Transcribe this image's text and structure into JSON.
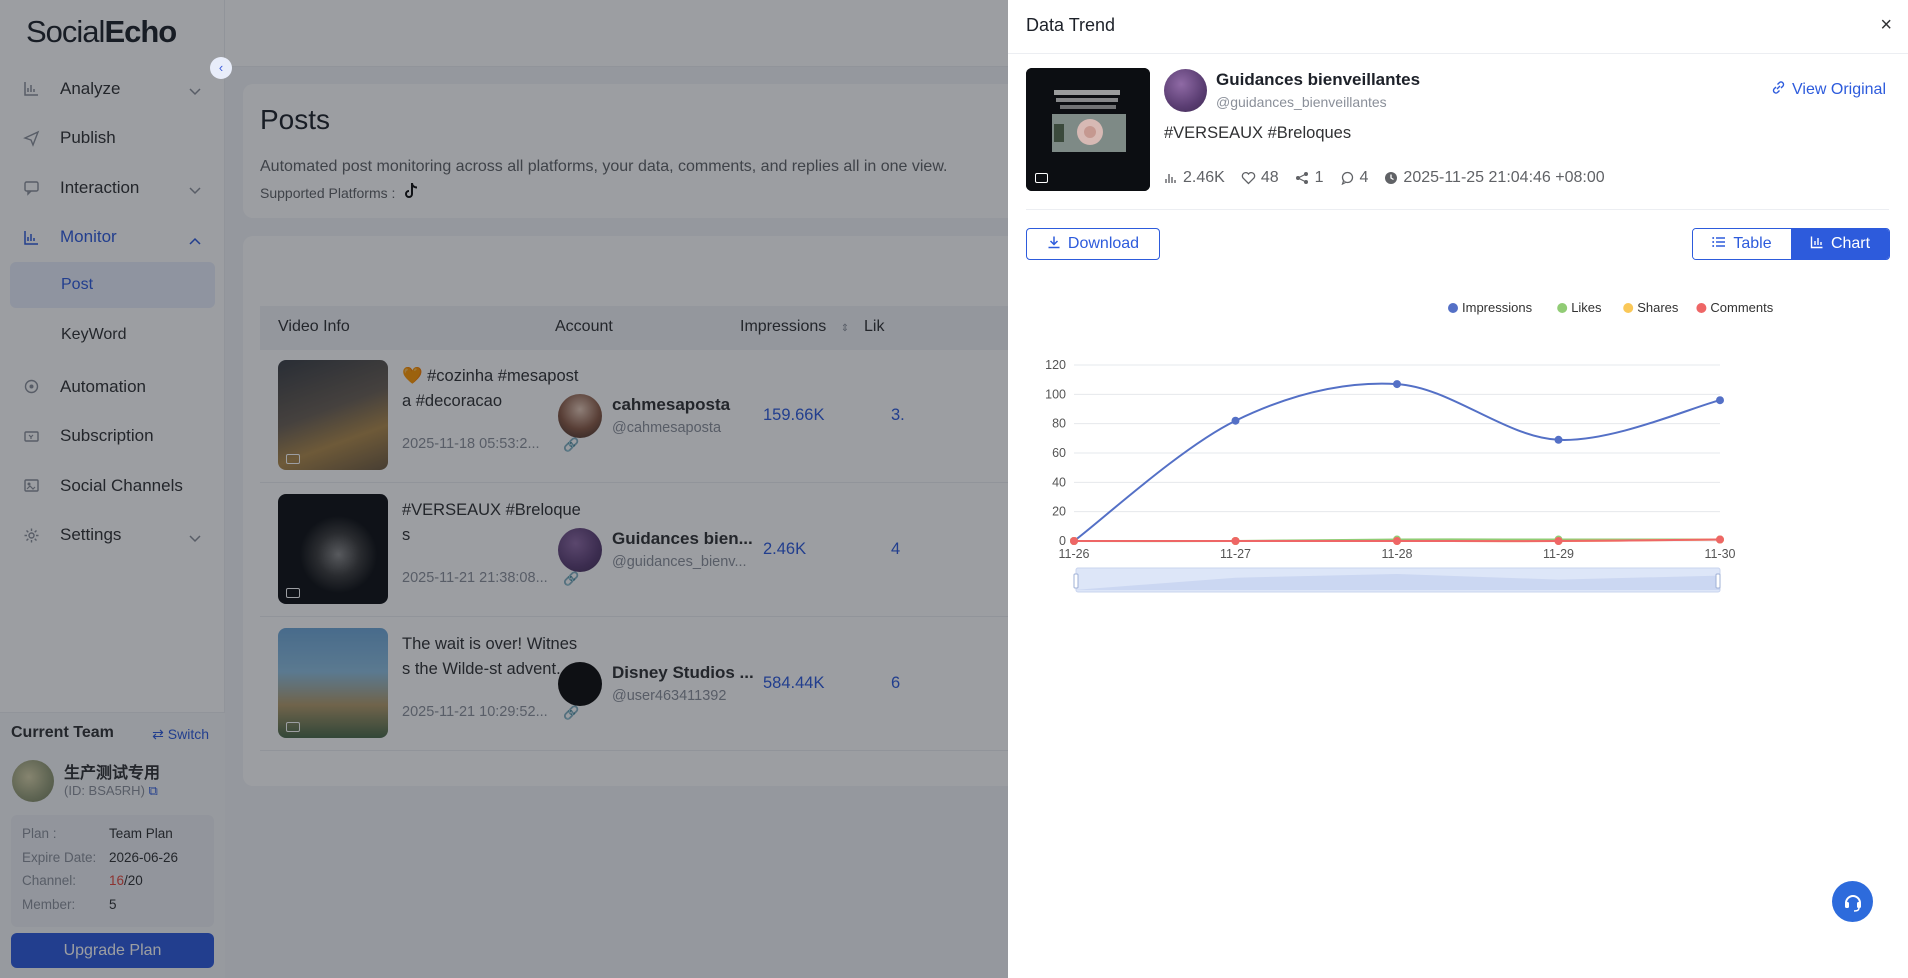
{
  "app": {
    "logo_part1": "Social",
    "logo_part2": "Echo"
  },
  "sidebar": {
    "items": [
      {
        "label": "Analyze",
        "icon": "chart-icon",
        "expandable": true
      },
      {
        "label": "Publish",
        "icon": "send-icon",
        "expandable": false
      },
      {
        "label": "Interaction",
        "icon": "chat-icon",
        "expandable": true
      },
      {
        "label": "Monitor",
        "icon": "monitor-icon",
        "expandable": true,
        "expanded": true
      },
      {
        "label": "Automation",
        "icon": "automation-icon",
        "expandable": false
      },
      {
        "label": "Subscription",
        "icon": "subscription-icon",
        "expandable": false
      },
      {
        "label": "Social Channels",
        "icon": "channels-icon",
        "expandable": false
      },
      {
        "label": "Settings",
        "icon": "gear-icon",
        "expandable": true
      }
    ],
    "sub_items": [
      {
        "label": "Post",
        "active": true
      },
      {
        "label": "KeyWord",
        "active": false
      }
    ]
  },
  "team": {
    "heading": "Current Team",
    "switch_label": "Switch",
    "name": "生产测试专用",
    "id": "(ID: BSA5RH)",
    "plan_label": "Plan :",
    "plan_value": "Team Plan",
    "expire_label": "Expire Date:",
    "expire_value": "2026-06-26",
    "channel_label": "Channel:",
    "channel_used": "16",
    "channel_total": "/20",
    "member_label": "Member:",
    "member_value": "5",
    "upgrade_label": "Upgrade Plan"
  },
  "page": {
    "title": "Posts",
    "description": "Automated post monitoring across all platforms, your data, comments, and replies all in one view.",
    "platforms_label": "Supported Platforms :"
  },
  "table": {
    "columns": [
      "Video Info",
      "Account",
      "Impressions",
      "Lik"
    ],
    "rows": [
      {
        "text": "🧡 #cozinha #mesaposta #decoracao",
        "date": "2025-11-18 05:53:2...",
        "account_name": "cahmesaposta",
        "account_handle": "@cahmesaposta",
        "impressions": "159.66K",
        "likes": "3."
      },
      {
        "text": "#VERSEAUX #Breloques",
        "date": "2025-11-21 21:38:08...",
        "account_name": "Guidances bien...",
        "account_handle": "@guidances_bienv...",
        "impressions": "2.46K",
        "likes": "4"
      },
      {
        "text": "The wait is over! Witness the Wilde-st advent...",
        "date": "2025-11-21 10:29:52...",
        "account_name": "Disney Studios ...",
        "account_handle": "@user463411392",
        "impressions": "584.44K",
        "likes": "6"
      }
    ]
  },
  "drawer": {
    "title": "Data Trend",
    "close": "×",
    "account_name": "Guidances bienveillantes",
    "account_handle": "@guidances_bienveillantes",
    "view_original": "View Original",
    "caption": "#VERSEAUX #Breloques",
    "stats": {
      "views": "2.46K",
      "likes": "48",
      "shares": "1",
      "comments": "4",
      "time": "2025-11-25 21:04:46 +08:00"
    },
    "download_label": "Download",
    "table_label": "Table",
    "chart_label": "Chart"
  },
  "colors": {
    "accent": "#2d5bdc",
    "impressions": "#5470c6",
    "likes": "#91cc75",
    "shares": "#fac858",
    "comments": "#ee6666"
  },
  "chart_data": {
    "type": "line",
    "x": [
      "11-26",
      "11-27",
      "11-28",
      "11-29",
      "11-30"
    ],
    "ylim": [
      0,
      120
    ],
    "yticks": [
      0,
      20,
      40,
      60,
      80,
      100,
      120
    ],
    "legend_position": "top-right",
    "grid": true,
    "smooth": true,
    "data_zoom_slider": true,
    "series": [
      {
        "name": "Impressions",
        "color": "#5470c6",
        "values": [
          0,
          82,
          107,
          69,
          96
        ]
      },
      {
        "name": "Likes",
        "color": "#91cc75",
        "values": [
          0,
          0,
          1,
          1,
          1
        ]
      },
      {
        "name": "Shares",
        "color": "#fac858",
        "values": [
          0,
          0,
          0,
          0,
          1
        ]
      },
      {
        "name": "Comments",
        "color": "#ee6666",
        "values": [
          0,
          0,
          0,
          0,
          1
        ]
      }
    ]
  }
}
